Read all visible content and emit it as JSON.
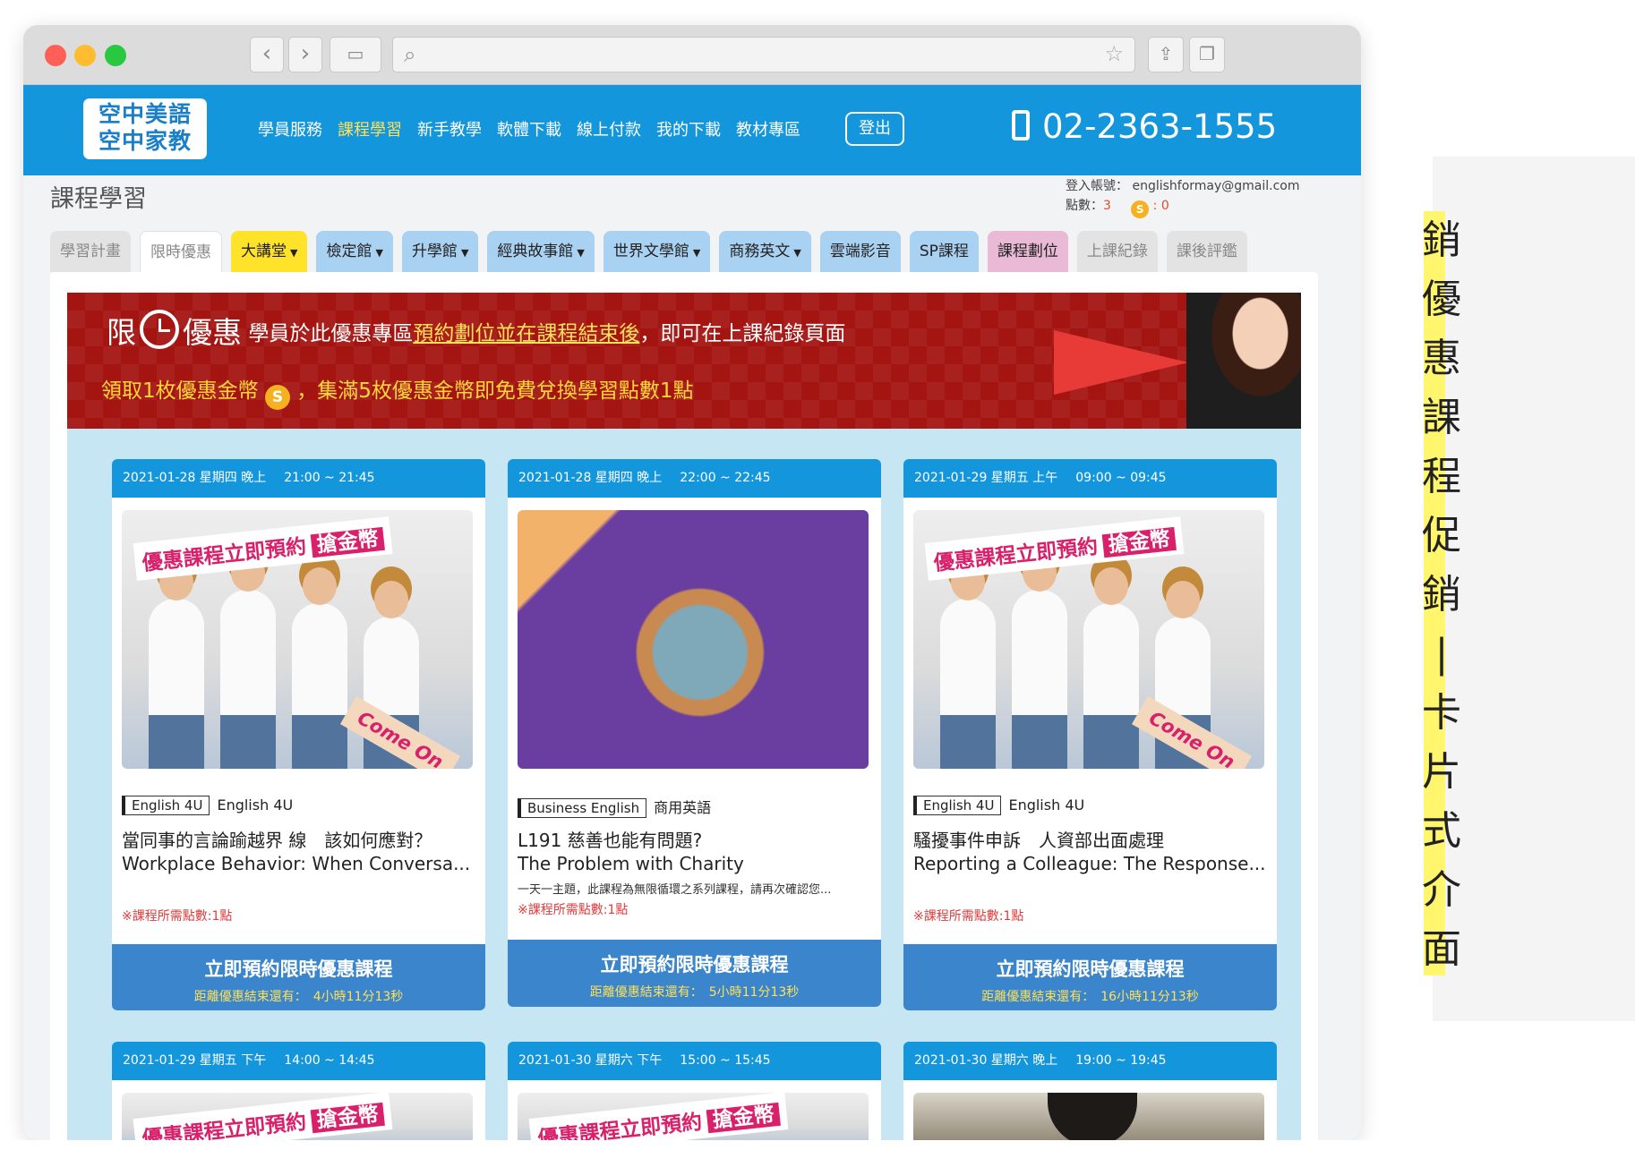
{
  "site": {
    "logo_line1": "空中美語",
    "logo_line2": "空中家教",
    "nav": [
      "學員服務",
      "課程學習",
      "新手教學",
      "軟體下載",
      "線上付款",
      "我的下載",
      "教材專區"
    ],
    "logout_label": "登出",
    "phone": "02-2363-1555",
    "accent_color": "#1496dc"
  },
  "page": {
    "title": "課程學習",
    "account_label": "登入帳號：",
    "account_email": "englishformay@gmail.com",
    "points_label": "點數：",
    "points_value": "3",
    "coin_value": "0"
  },
  "tabs": [
    {
      "label": "學習計畫",
      "style": "gray",
      "dropdown": false
    },
    {
      "label": "限時優惠",
      "style": "white",
      "dropdown": false
    },
    {
      "label": "大講堂",
      "style": "yellow",
      "dropdown": true
    },
    {
      "label": "檢定館",
      "style": "blue",
      "dropdown": true
    },
    {
      "label": "升學館",
      "style": "blue",
      "dropdown": true
    },
    {
      "label": "經典故事館",
      "style": "blue",
      "dropdown": true
    },
    {
      "label": "世界文學館",
      "style": "blue",
      "dropdown": true
    },
    {
      "label": "商務英文",
      "style": "blue",
      "dropdown": true
    },
    {
      "label": "雲端影音",
      "style": "blue",
      "dropdown": false
    },
    {
      "label": "SP課程",
      "style": "blue",
      "dropdown": false
    },
    {
      "label": "課程劃位",
      "style": "pink",
      "dropdown": false
    },
    {
      "label": "上課紀錄",
      "style": "gray",
      "dropdown": false
    },
    {
      "label": "課後評鑑",
      "style": "gray",
      "dropdown": false
    }
  ],
  "banner": {
    "limit": "限",
    "offer": "優惠",
    "text_pre": "學員於此優惠專區",
    "text_link": "預約劃位並在課程結束後",
    "text_post": "，即可在上課紀錄頁面",
    "line2_a": "領取1枚優惠金幣",
    "line2_b": "，集滿5枚優惠金幣即免費兌換學習點數1點"
  },
  "coin_icon": "S",
  "poster": {
    "sign_text": "優惠課程立即預約",
    "sign_highlight": "搶金幣",
    "arrow_text": "Come On"
  },
  "cards": [
    {
      "date": "2021-01-28 星期四 晚上",
      "time": "21:00 ~ 21:45",
      "tag": "English 4U",
      "tag_label": "English 4U",
      "title_zh": "當同事的言論踰越界 線　該如何應對？",
      "title_en": "Workplace Behavior: When Conversa...",
      "desc": "",
      "points": "※課程所需點數:1點",
      "cta": "立即預約限時優惠課程",
      "countdown": "距離優惠結束還有：　4小時11分13秒"
    },
    {
      "date": "2021-01-28 星期四 晚上",
      "time": "22:00 ~ 22:45",
      "tag": "Business English",
      "tag_label": "商用英語",
      "title_zh": "L191 慈善也能有問題?",
      "title_en": "The Problem with Charity",
      "desc": "一天一主題，此課程為無限循環之系列課程，請再次確認您...",
      "points": "※課程所需點數:1點",
      "cta": "立即預約限時優惠課程",
      "countdown": "距離優惠結束還有：　5小時11分13秒"
    },
    {
      "date": "2021-01-29 星期五 上午",
      "time": "09:00 ~ 09:45",
      "tag": "English 4U",
      "tag_label": "English 4U",
      "title_zh": "騷擾事件申訴　人資部出面處理",
      "title_en": "Reporting a Colleague: The Response...",
      "desc": "",
      "points": "※課程所需點數:1點",
      "cta": "立即預約限時優惠課程",
      "countdown": "距離優惠結束還有：　16小時11分13秒"
    }
  ],
  "cards_row2": [
    {
      "date": "2021-01-29 星期五 下午",
      "time": "14:00 ~ 14:45"
    },
    {
      "date": "2021-01-30 星期六 下午",
      "time": "15:00 ~ 15:45"
    },
    {
      "date": "2021-01-30 星期六 晚上",
      "time": "19:00 ~ 19:45"
    }
  ],
  "side_caption": [
    "銷",
    "優",
    "惠",
    "課",
    "程",
    "促",
    "銷",
    "|",
    "卡",
    "片",
    "式",
    "介",
    "面"
  ]
}
